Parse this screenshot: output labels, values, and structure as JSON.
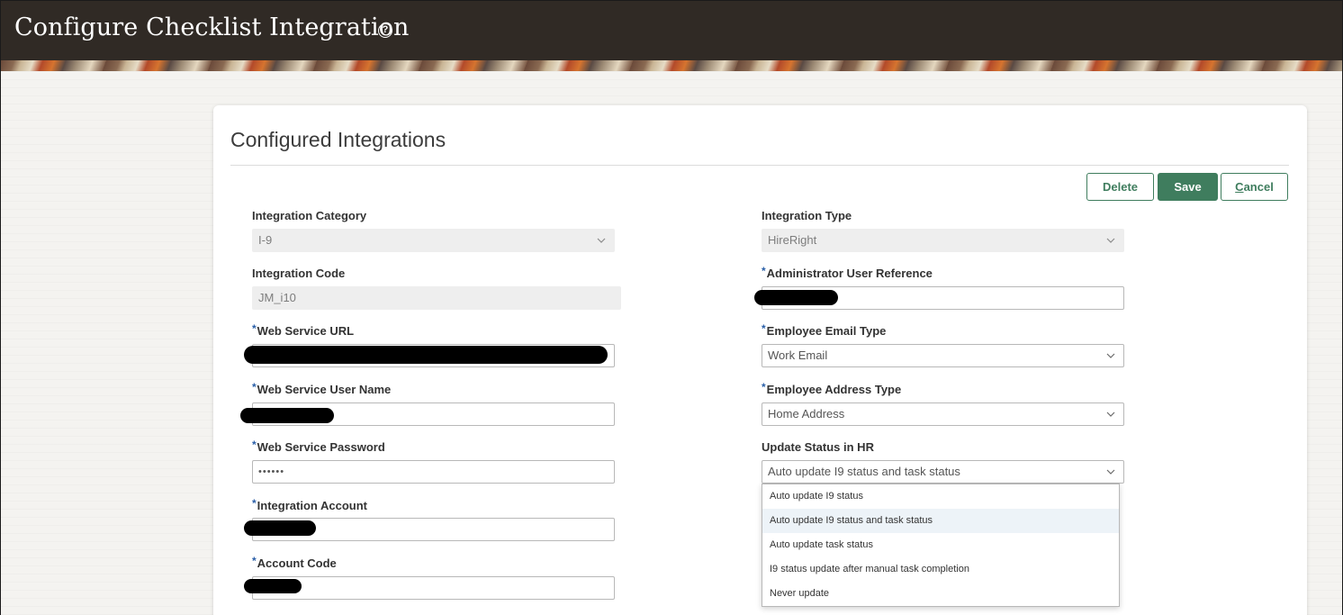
{
  "header": {
    "title": "Configure Checklist Integration",
    "help_icon": "question-circle-icon"
  },
  "card": {
    "title": "Configured Integrations"
  },
  "toolbar": {
    "delete_label": "Delete",
    "save_label": "Save",
    "cancel_prefix": "C",
    "cancel_rest": "ancel"
  },
  "colors": {
    "accent": "#3f7d5e",
    "header_bg": "#302a25",
    "required_marker": "#2a5fa8"
  },
  "left_fields": {
    "integration_category": {
      "label": "Integration Category",
      "value": "I-9"
    },
    "integration_code": {
      "label": "Integration Code",
      "value": "JM_i10"
    },
    "web_service_url": {
      "label": "Web Service URL",
      "value": ""
    },
    "web_service_user_name": {
      "label": "Web Service User Name",
      "value": ""
    },
    "web_service_password": {
      "label": "Web Service Password",
      "value": "••••••"
    },
    "integration_account": {
      "label": "Integration Account",
      "value": ""
    },
    "account_code": {
      "label": "Account Code",
      "value": ""
    }
  },
  "right_fields": {
    "integration_type": {
      "label": "Integration Type",
      "value": "HireRight"
    },
    "administrator_user_reference": {
      "label": "Administrator User Reference",
      "value": ""
    },
    "employee_email_type": {
      "label": "Employee Email Type",
      "value": "Work Email"
    },
    "employee_address_type": {
      "label": "Employee Address Type",
      "value": "Home Address"
    },
    "update_status_in_hr": {
      "label": "Update Status in HR",
      "value": "Auto update I9 status and task status"
    }
  },
  "required_marker": "*",
  "update_status_options": [
    "Auto update I9 status",
    "Auto update I9 status and task status",
    "Auto update task status",
    "I9 status update after manual task completion",
    "Never update"
  ]
}
